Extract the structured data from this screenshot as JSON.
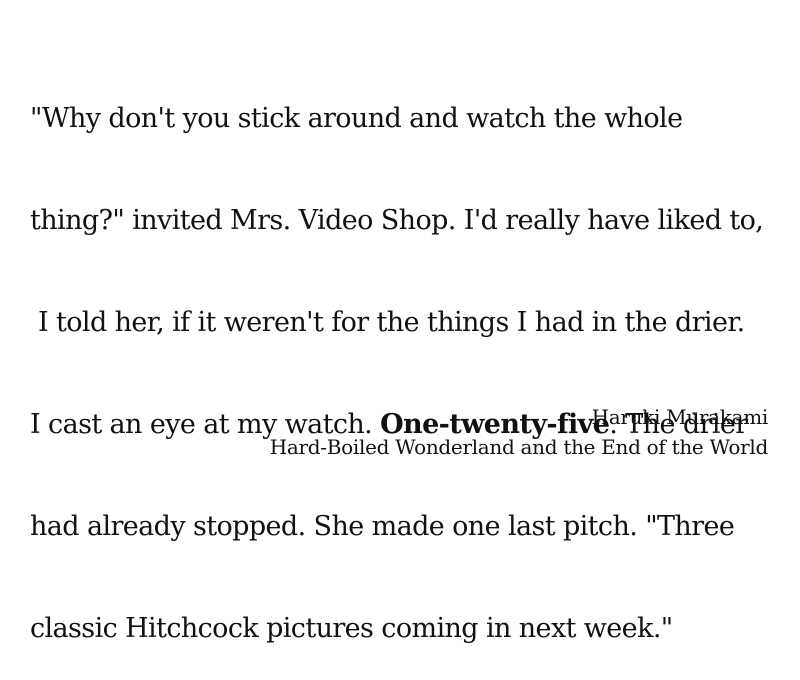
{
  "quote": {
    "line1": "\"Why don't you stick around and watch the whole",
    "line2": "thing?\" invited Mrs. Video Shop. I'd really have liked to,",
    "line3": " I told her, if it weren't for the things I had in the drier.",
    "line4_before": "I cast an eye at my watch. ",
    "line4_bold": "One-twenty-five",
    "line4_after": ". The drier",
    "line5": "had already stopped. She made one last pitch. \"Three",
    "line6": "classic Hitchcock pictures coming in next week.\""
  },
  "attribution": {
    "author": "Haruki Murakami",
    "work": "Hard-Boiled Wonderland and the End of the World"
  }
}
